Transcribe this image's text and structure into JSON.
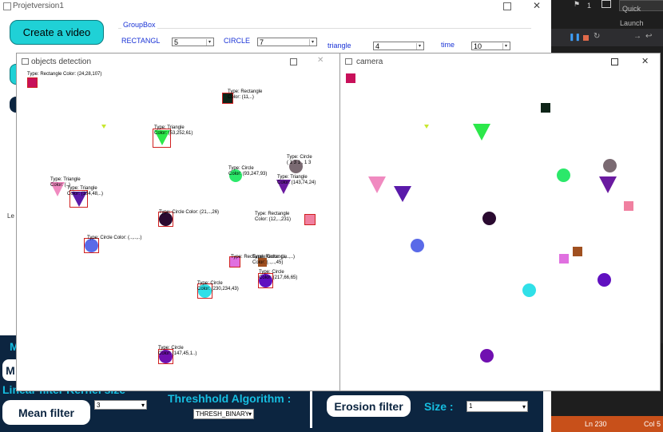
{
  "main": {
    "title": "Projetversion1",
    "create_video_label": "Create a video",
    "groupbox_title": "GroupBox",
    "rectangle_label": "RECTANGL",
    "rectangle_value": "5",
    "circle_label": "CIRCLE",
    "circle_value": "7",
    "triangle_label": "triangle",
    "triangle_value": "4",
    "time_label": "time",
    "time_value": "10",
    "partial_button_label": "M",
    "partial_left_label": "M",
    "partial_left_label2": "Le",
    "linear_filter_label": "Linear filter  Kernel size",
    "mean_filter_label": "Mean filter",
    "kernel_value": "3",
    "threshold_label": "Threshhold Algorithm :",
    "threshold_value": "THRESH_BINARY",
    "erosion_label": "Erosion filter",
    "size_label": "Size :",
    "size_value": "1"
  },
  "ide": {
    "counter": "1",
    "quick_launch": "Quick Launch",
    "status_line": "Ln 230",
    "status_col": "Col 5"
  },
  "objects_window": {
    "title": "objects detection",
    "annotations": [
      {
        "l1": "Type: Rectangle",
        "l2": "Color: (24,28,107)"
      },
      {
        "l1": "Type: Rectangle",
        "l2": "Color: (11,..)"
      },
      {
        "l1": "Type: Triangle",
        "l2": "Color: (53,252,61)"
      },
      {
        "l1": "Type: Circle",
        "l2": "( 1 3 1 , 1 3"
      },
      {
        "l1": "Type: Circle",
        "l2": "Color: (93,247,93)"
      },
      {
        "l1": "Type: Triangle",
        "l2": "Color: (143,74,24)"
      },
      {
        "l1": "Type: Triangle",
        "l2": "Color: (..)"
      },
      {
        "l1": "Type: Triangle",
        "l2": "Color: (184,48,..)"
      },
      {
        "l1": "Type: Circle",
        "l2": "Color: (21,..,26)"
      },
      {
        "l1": "Type: Rectangle",
        "l2": "Color: (12,..,231)"
      },
      {
        "l1": "Type: Circle",
        "l2": "Color: (..,..,..)"
      },
      {
        "l1": "Type: Rectangle",
        "l2": "Color: (..,..,..)"
      },
      {
        "l1": "Type: Rectangle",
        "l2": "Color: (..,..,45)"
      },
      {
        "l1": "Type: Circle",
        "l2": "Color: (217,66,65)"
      },
      {
        "l1": "Type: Circle",
        "l2": "Color: (230,234,43)"
      },
      {
        "l1": "Type: Circle",
        "l2": "Color: (147,45,1..)"
      }
    ]
  },
  "camera_window": {
    "title": "camera"
  },
  "colors": {
    "teal_button": "#1fd1d6",
    "bottom_panel": "#0c2540",
    "cyan_label": "#16bde0",
    "ide_status": "#c8501a"
  }
}
